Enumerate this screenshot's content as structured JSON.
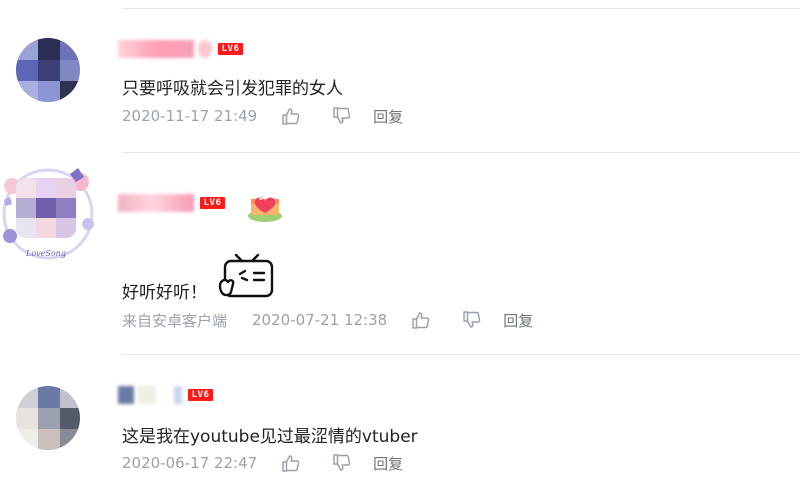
{
  "comments": [
    {
      "level": "LV6",
      "text": "只要呼吸就会引发犯罪的女人",
      "source": "",
      "time": "2020-11-17 21:49",
      "reply_label": "回复"
    },
    {
      "level": "LV6",
      "text": "好听好听！",
      "source": "来自安卓客户端",
      "time": "2020-07-21 12:38",
      "reply_label": "回复",
      "avatar_tag": "LoveSong",
      "medal_icon": "heart-gift-icon",
      "emote_icon": "bilibili-tv-emote-icon"
    },
    {
      "level": "LV6",
      "text": "这是我在youtube见过最涩情的vtuber",
      "source": "",
      "time": "2020-06-17 22:47",
      "reply_label": "回复"
    }
  ],
  "colors": {
    "level_badge": "#ff1a1a",
    "meta_text": "#99a2aa",
    "divider": "#e5e9ef"
  }
}
